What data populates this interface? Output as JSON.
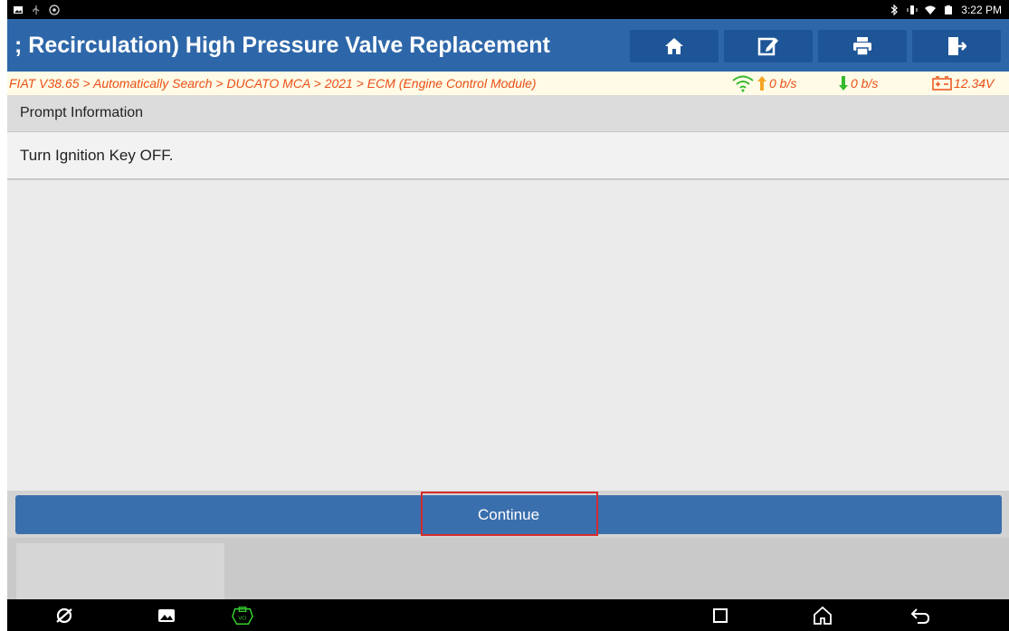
{
  "status_bar": {
    "left_icons": [
      "image-icon",
      "usb-icon",
      "settings-icon"
    ],
    "right_icons": [
      "bluetooth-icon",
      "vibrate-icon",
      "wifi-icon",
      "battery-icon"
    ],
    "time": "3:22 PM"
  },
  "header": {
    "title": "; Recirculation) High Pressure Valve Replacement",
    "buttons": [
      {
        "name": "home-button",
        "icon": "home-icon"
      },
      {
        "name": "edit-button",
        "icon": "edit-icon"
      },
      {
        "name": "print-button",
        "icon": "printer-icon"
      },
      {
        "name": "exit-button",
        "icon": "exit-icon"
      }
    ]
  },
  "breadcrumb": {
    "path": "FIAT V38.65 > Automatically Search > DUCATO MCA > 2021 > ECM (Engine Control Module)",
    "upload": "0 b/s",
    "download": "0 b/s",
    "voltage": "12.34V"
  },
  "prompt": {
    "heading": "Prompt Information",
    "message": "Turn Ignition Key OFF."
  },
  "actions": {
    "continue_label": "Continue"
  },
  "nav_bar": {
    "left_icons": [
      "browser-icon",
      "gallery-icon",
      "vci-icon"
    ],
    "right_icons": [
      "recent-apps-icon",
      "home-nav-icon",
      "back-icon"
    ]
  },
  "colors": {
    "header_blue": "#2e67a9",
    "button_blue": "#3a6fad",
    "crumb_orange": "#ea4f17",
    "signal_green": "#35b92d",
    "arrow_orange": "#f5a623"
  }
}
